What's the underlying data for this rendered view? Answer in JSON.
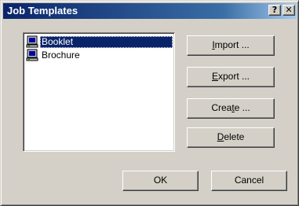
{
  "window": {
    "title": "Job Templates",
    "help_glyph": "?",
    "close_glyph": "✕"
  },
  "templates": [
    {
      "label": "Booklet",
      "icon": "computer-icon",
      "selected": true
    },
    {
      "label": "Brochure",
      "icon": "computer-icon",
      "selected": false
    }
  ],
  "buttons": {
    "import": {
      "pre": "",
      "accel": "I",
      "post": "mport ..."
    },
    "export": {
      "pre": "",
      "accel": "E",
      "post": "xport ..."
    },
    "create": {
      "pre": "Crea",
      "accel": "t",
      "post": "e ..."
    },
    "delete": {
      "pre": "",
      "accel": "D",
      "post": "elete"
    },
    "ok": "OK",
    "cancel": "Cancel"
  },
  "colors": {
    "titlebar_start": "#0a246a",
    "titlebar_end": "#a6caf0",
    "face": "#d4d0c8",
    "selection": "#0a246a"
  }
}
